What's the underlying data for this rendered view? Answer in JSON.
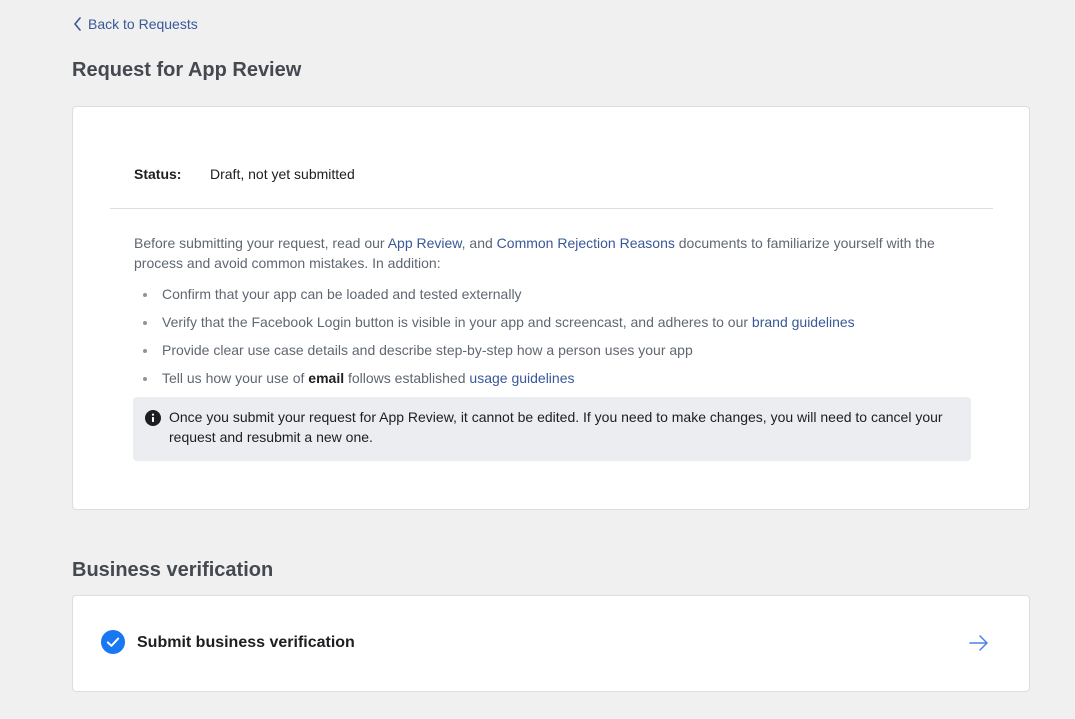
{
  "nav": {
    "back_label": "Back to Requests"
  },
  "page": {
    "title": "Request for App Review"
  },
  "review": {
    "status_label": "Status:",
    "status_value": "Draft, not yet submitted",
    "intro": {
      "part1": "Before submitting your request, read our ",
      "link_app_review": "App Review",
      "part2": ", and ",
      "link_rejection": "Common Rejection Reasons",
      "part3": " documents to familiarize yourself with the process and avoid common mistakes. In addition:"
    },
    "checklist": {
      "item1": "Confirm that your app can be loaded and tested externally",
      "item2_text": "Verify that the Facebook Login button is visible in your app and screencast, and adheres to our ",
      "item2_link": "brand guidelines",
      "item3": "Provide clear use case details and describe step-by-step how a person uses your app",
      "item4_prefix": "Tell us how your use of ",
      "item4_bold": "email",
      "item4_middle": " follows established ",
      "item4_link": "usage guidelines"
    },
    "notice": "Once you submit your request for App Review, it cannot be edited. If you need to make changes, you will need to cancel your request and resubmit a new one."
  },
  "business": {
    "section_title": "Business verification",
    "item_label": "Submit business verification",
    "item_completed": true
  },
  "icons": {
    "back": "chevron-left-icon",
    "info": "info-icon",
    "check": "check-circle-icon",
    "arrow": "arrow-right-icon"
  },
  "colors": {
    "link": "#385898",
    "check_blue": "#1877f2",
    "arrow_blue": "#4a82e8",
    "page_bg": "#f0f0f0"
  }
}
